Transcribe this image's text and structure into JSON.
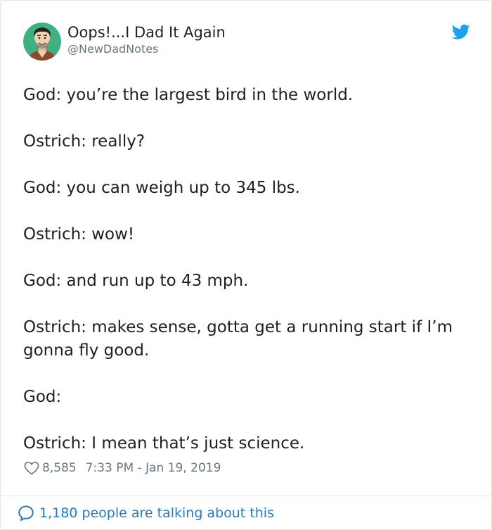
{
  "user": {
    "name": "Oops!...I Dad It Again",
    "handle": "@NewDadNotes"
  },
  "icons": {
    "avatar": "avatar",
    "brand": "twitter-bird-icon",
    "like": "heart-icon",
    "reply": "speech-bubble-icon"
  },
  "colors": {
    "brand": "#1da1f2",
    "link": "#2b7bb9",
    "meta": "#697882",
    "avatar_bg": "#3fb07f"
  },
  "tweet": {
    "lines": [
      "God: you’re the largest bird in the world.",
      "Ostrich: really?",
      "God: you can weigh up to 345 lbs.",
      "Ostrich: wow!",
      "God: and run up to 43 mph.",
      "Ostrich: makes sense, gotta get a running start if I’m gonna fly good.",
      "God:",
      "Ostrich: I mean that’s just science."
    ],
    "likes": "8,585",
    "timestamp": "7:33 PM - Jan 19, 2019"
  },
  "footer": {
    "talking": "1,180 people are talking about this"
  }
}
